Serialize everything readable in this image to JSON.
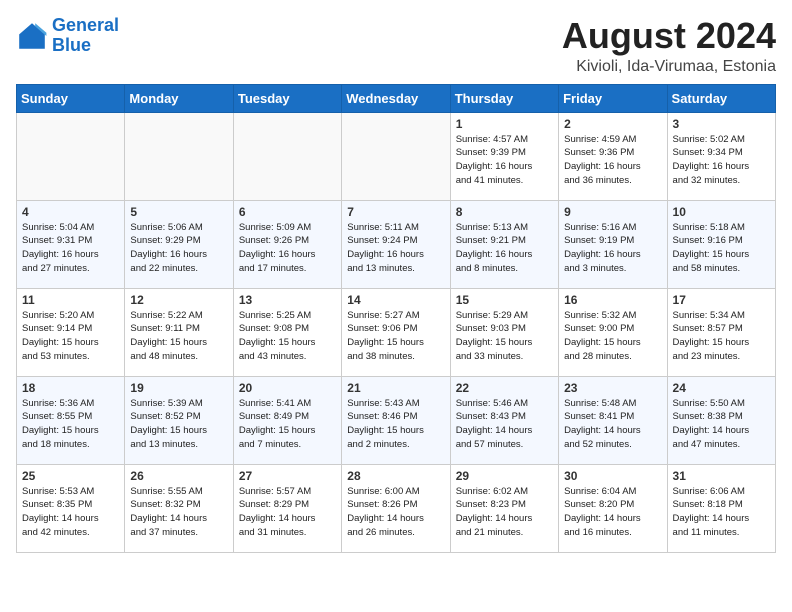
{
  "header": {
    "logo_line1": "General",
    "logo_line2": "Blue",
    "month_year": "August 2024",
    "location": "Kivioli, Ida-Virumaa, Estonia"
  },
  "weekdays": [
    "Sunday",
    "Monday",
    "Tuesday",
    "Wednesday",
    "Thursday",
    "Friday",
    "Saturday"
  ],
  "weeks": [
    [
      {
        "day": "",
        "info": ""
      },
      {
        "day": "",
        "info": ""
      },
      {
        "day": "",
        "info": ""
      },
      {
        "day": "",
        "info": ""
      },
      {
        "day": "1",
        "info": "Sunrise: 4:57 AM\nSunset: 9:39 PM\nDaylight: 16 hours\nand 41 minutes."
      },
      {
        "day": "2",
        "info": "Sunrise: 4:59 AM\nSunset: 9:36 PM\nDaylight: 16 hours\nand 36 minutes."
      },
      {
        "day": "3",
        "info": "Sunrise: 5:02 AM\nSunset: 9:34 PM\nDaylight: 16 hours\nand 32 minutes."
      }
    ],
    [
      {
        "day": "4",
        "info": "Sunrise: 5:04 AM\nSunset: 9:31 PM\nDaylight: 16 hours\nand 27 minutes."
      },
      {
        "day": "5",
        "info": "Sunrise: 5:06 AM\nSunset: 9:29 PM\nDaylight: 16 hours\nand 22 minutes."
      },
      {
        "day": "6",
        "info": "Sunrise: 5:09 AM\nSunset: 9:26 PM\nDaylight: 16 hours\nand 17 minutes."
      },
      {
        "day": "7",
        "info": "Sunrise: 5:11 AM\nSunset: 9:24 PM\nDaylight: 16 hours\nand 13 minutes."
      },
      {
        "day": "8",
        "info": "Sunrise: 5:13 AM\nSunset: 9:21 PM\nDaylight: 16 hours\nand 8 minutes."
      },
      {
        "day": "9",
        "info": "Sunrise: 5:16 AM\nSunset: 9:19 PM\nDaylight: 16 hours\nand 3 minutes."
      },
      {
        "day": "10",
        "info": "Sunrise: 5:18 AM\nSunset: 9:16 PM\nDaylight: 15 hours\nand 58 minutes."
      }
    ],
    [
      {
        "day": "11",
        "info": "Sunrise: 5:20 AM\nSunset: 9:14 PM\nDaylight: 15 hours\nand 53 minutes."
      },
      {
        "day": "12",
        "info": "Sunrise: 5:22 AM\nSunset: 9:11 PM\nDaylight: 15 hours\nand 48 minutes."
      },
      {
        "day": "13",
        "info": "Sunrise: 5:25 AM\nSunset: 9:08 PM\nDaylight: 15 hours\nand 43 minutes."
      },
      {
        "day": "14",
        "info": "Sunrise: 5:27 AM\nSunset: 9:06 PM\nDaylight: 15 hours\nand 38 minutes."
      },
      {
        "day": "15",
        "info": "Sunrise: 5:29 AM\nSunset: 9:03 PM\nDaylight: 15 hours\nand 33 minutes."
      },
      {
        "day": "16",
        "info": "Sunrise: 5:32 AM\nSunset: 9:00 PM\nDaylight: 15 hours\nand 28 minutes."
      },
      {
        "day": "17",
        "info": "Sunrise: 5:34 AM\nSunset: 8:57 PM\nDaylight: 15 hours\nand 23 minutes."
      }
    ],
    [
      {
        "day": "18",
        "info": "Sunrise: 5:36 AM\nSunset: 8:55 PM\nDaylight: 15 hours\nand 18 minutes."
      },
      {
        "day": "19",
        "info": "Sunrise: 5:39 AM\nSunset: 8:52 PM\nDaylight: 15 hours\nand 13 minutes."
      },
      {
        "day": "20",
        "info": "Sunrise: 5:41 AM\nSunset: 8:49 PM\nDaylight: 15 hours\nand 7 minutes."
      },
      {
        "day": "21",
        "info": "Sunrise: 5:43 AM\nSunset: 8:46 PM\nDaylight: 15 hours\nand 2 minutes."
      },
      {
        "day": "22",
        "info": "Sunrise: 5:46 AM\nSunset: 8:43 PM\nDaylight: 14 hours\nand 57 minutes."
      },
      {
        "day": "23",
        "info": "Sunrise: 5:48 AM\nSunset: 8:41 PM\nDaylight: 14 hours\nand 52 minutes."
      },
      {
        "day": "24",
        "info": "Sunrise: 5:50 AM\nSunset: 8:38 PM\nDaylight: 14 hours\nand 47 minutes."
      }
    ],
    [
      {
        "day": "25",
        "info": "Sunrise: 5:53 AM\nSunset: 8:35 PM\nDaylight: 14 hours\nand 42 minutes."
      },
      {
        "day": "26",
        "info": "Sunrise: 5:55 AM\nSunset: 8:32 PM\nDaylight: 14 hours\nand 37 minutes."
      },
      {
        "day": "27",
        "info": "Sunrise: 5:57 AM\nSunset: 8:29 PM\nDaylight: 14 hours\nand 31 minutes."
      },
      {
        "day": "28",
        "info": "Sunrise: 6:00 AM\nSunset: 8:26 PM\nDaylight: 14 hours\nand 26 minutes."
      },
      {
        "day": "29",
        "info": "Sunrise: 6:02 AM\nSunset: 8:23 PM\nDaylight: 14 hours\nand 21 minutes."
      },
      {
        "day": "30",
        "info": "Sunrise: 6:04 AM\nSunset: 8:20 PM\nDaylight: 14 hours\nand 16 minutes."
      },
      {
        "day": "31",
        "info": "Sunrise: 6:06 AM\nSunset: 8:18 PM\nDaylight: 14 hours\nand 11 minutes."
      }
    ]
  ]
}
